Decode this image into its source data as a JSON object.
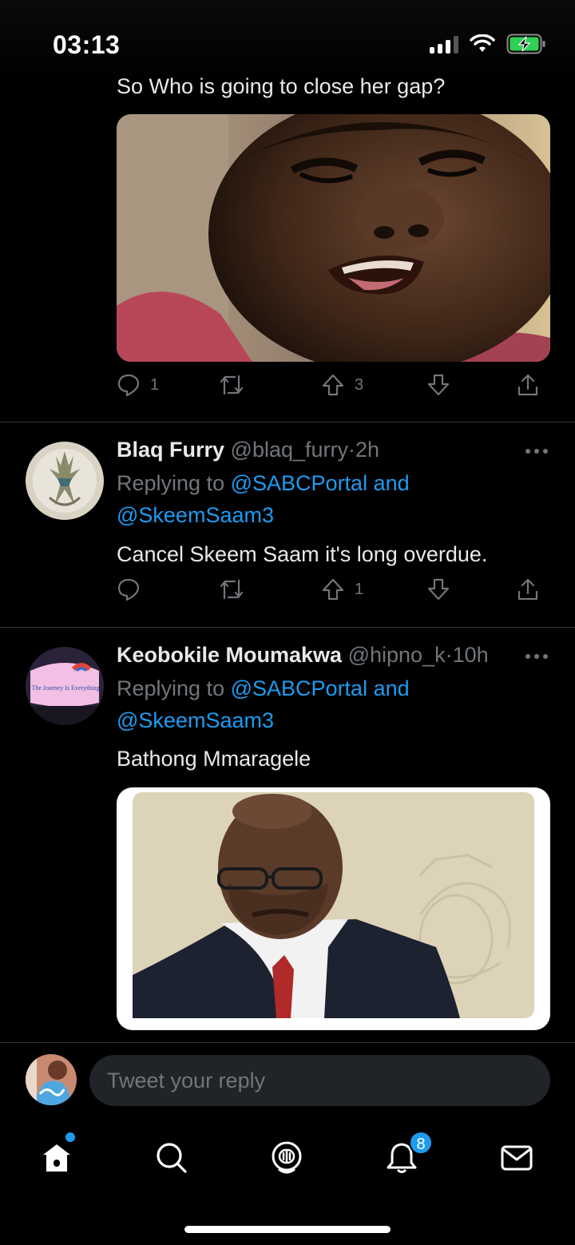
{
  "status_bar": {
    "time": "03:13"
  },
  "tweet1": {
    "text": "So Who is going to close her gap?",
    "reply_count": "1",
    "upvote_count": "3"
  },
  "tweet2": {
    "name": "Blaq Furry",
    "handle": "@blaq_furry",
    "time": "2h",
    "replying_prefix": "Replying to",
    "replying_to_1": "@SABCPortal and",
    "replying_to_2": "@SkeemSaam3",
    "text": "Cancel Skeem Saam it's long overdue.",
    "upvote_count": "1"
  },
  "tweet3": {
    "name": "Keobokile Moumakwa",
    "handle": "@hipno_k",
    "time": "10h",
    "replying_prefix": "Replying to",
    "replying_to_1": "@SABCPortal and",
    "replying_to_2": "@SkeemSaam3",
    "text": "Bathong Mmaragele",
    "avatar_text": "The Journey Is Everything"
  },
  "reply_bar": {
    "placeholder": "Tweet your reply"
  },
  "tab_bar": {
    "notifications_badge": "8"
  },
  "colors": {
    "accent": "#1d9bf0",
    "background": "#000000",
    "muted": "#71767b",
    "divider": "#2f3336"
  }
}
